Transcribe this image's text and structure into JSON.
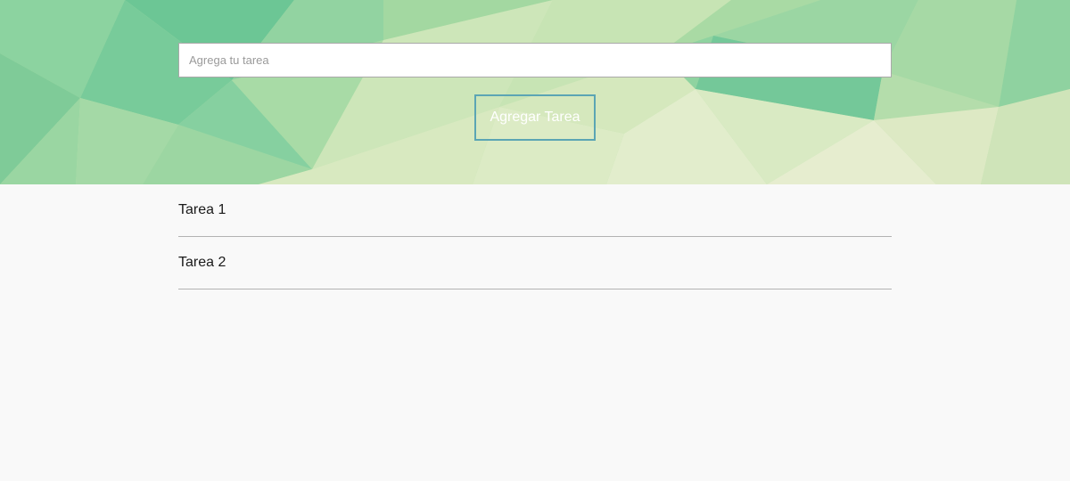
{
  "form": {
    "input_placeholder": "Agrega tu tarea",
    "input_value": "",
    "add_button_label": "Agregar Tarea"
  },
  "tasks": [
    {
      "label": "Tarea 1"
    },
    {
      "label": "Tarea 2"
    }
  ],
  "colors": {
    "page_background": "#f9f9f9",
    "button_border": "#5ba5b4",
    "button_text": "#ffffff",
    "divider": "#b3b3b3",
    "hero_green_dark": "#5ec08f",
    "hero_green_light": "#a6d79f",
    "hero_cream": "#e8ecd0"
  }
}
